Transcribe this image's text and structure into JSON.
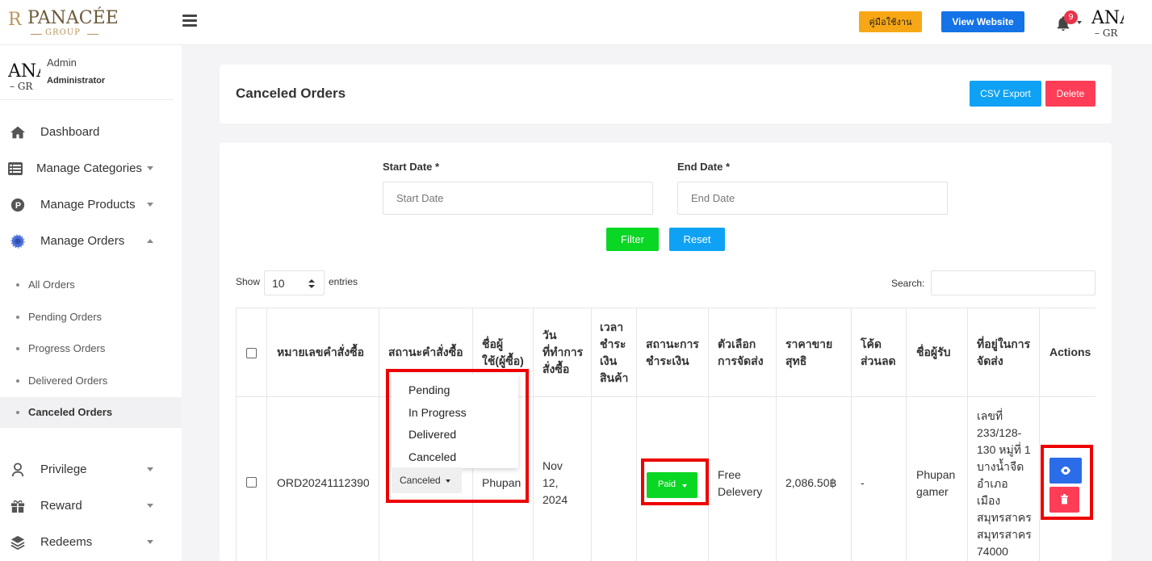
{
  "header": {
    "logo_brand": "PANACÉE",
    "logo_group": "GROUP",
    "logo_mark": "R",
    "manual_label": "คู่มือใช้งาน",
    "website_label": "View Website",
    "notifications": "9",
    "avatar_text": "ANA",
    "avatar_sub": "– GR"
  },
  "sidebar": {
    "avatar_text": "ANA",
    "avatar_sub": "– GR",
    "user": "Admin",
    "role": "Administrator",
    "items": [
      {
        "label": "Dashboard",
        "icon": "home-icon"
      },
      {
        "label": "Manage Categories",
        "icon": "list-icon"
      },
      {
        "label": "Manage Products",
        "icon": "product-icon"
      },
      {
        "label": "Manage Orders",
        "icon": "orders-icon"
      },
      {
        "label": "Privilege",
        "icon": "user-icon"
      },
      {
        "label": "Reward",
        "icon": "gift-icon"
      },
      {
        "label": "Redeems",
        "icon": "layers-icon"
      }
    ],
    "order_subitems": [
      "All Orders",
      "Pending Orders",
      "Progress Orders",
      "Delivered Orders",
      "Canceled Orders"
    ]
  },
  "page": {
    "title": "Canceled Orders",
    "csv_label": "CSV Export",
    "delete_label": "Delete"
  },
  "filter": {
    "start_label": "Start Date *",
    "start_placeholder": "Start Date",
    "end_label": "End Date *",
    "end_placeholder": "End Date",
    "filter_label": "Filter",
    "reset_label": "Reset"
  },
  "table_controls": {
    "show_label": "Show",
    "entries_value": "10",
    "entries_label": "entries",
    "search_label": "Search:"
  },
  "table": {
    "headers": {
      "order_no": "หมายเลขคำสั่งซื้อ",
      "order_status": "สถานะคำสั่งซื้อ",
      "user_name": [
        "ชื่อผู้",
        "ใช้(ผู้ซื้อ)"
      ],
      "order_date": [
        "วัน",
        "ที่ทำการ",
        "สั่งซื้อ"
      ],
      "pay_time": [
        "เวลา",
        "ชำระ",
        "เงิน",
        "สินค้า"
      ],
      "pay_status": [
        "สถานะการ",
        "ชำระเงิน"
      ],
      "shipping": [
        "ตัวเลือก",
        "การจัดส่ง"
      ],
      "net_price": [
        "ราคาขาย",
        "สุทธิ"
      ],
      "discount": [
        "โค้ด",
        "ส่วนลด"
      ],
      "receiver": "ชื่อผู้รับ",
      "address": [
        "ที่อยู่ในการ",
        "จัดส่ง"
      ],
      "actions": "Actions"
    },
    "row": {
      "order_no": "ORD20241112390",
      "status": "Canceled",
      "status_options": [
        "Pending",
        "In Progress",
        "Delivered",
        "Canceled"
      ],
      "user_name": "Phupan",
      "order_date": [
        "Nov",
        "12,",
        "2024"
      ],
      "pay_time": "",
      "pay_status": "Paid",
      "shipping": [
        "Free",
        "Delevery"
      ],
      "net_price": "2,086.50฿",
      "discount": "-",
      "receiver": [
        "Phupan",
        "gamer"
      ],
      "address": [
        "เลขที่",
        "233/128-",
        "130 หมู่ที่ 1",
        "บางน้ำจืด",
        "อำเภอ",
        "เมือง",
        "สมุทรสาคร",
        "สมุทรสาคร",
        "74000"
      ]
    }
  },
  "colors": {
    "manual": "#f7a716",
    "website": "#1473e6",
    "csv": "#0fa2f4",
    "delete": "#ff3d57",
    "filter": "#0ad624",
    "highlight": "#ee0000"
  }
}
